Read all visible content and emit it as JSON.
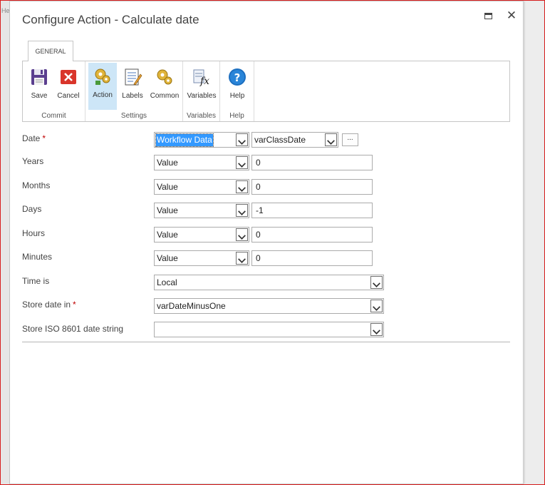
{
  "background": {
    "tab_fragment": "He"
  },
  "dialog": {
    "title": "Configure Action - Calculate date",
    "maximize_icon": "maximize-icon",
    "close_glyph": "✕"
  },
  "ribbon": {
    "tab": "GENERAL",
    "groups": [
      {
        "label": "Commit",
        "buttons": [
          {
            "label": "Save",
            "icon": "floppy-disk-icon"
          },
          {
            "label": "Cancel",
            "icon": "red-x-icon"
          }
        ]
      },
      {
        "label": "Settings",
        "buttons": [
          {
            "label": "Action",
            "icon": "gears-icon",
            "active": true
          },
          {
            "label": "Labels",
            "icon": "labels-notepad-icon"
          },
          {
            "label": "Common",
            "icon": "gears-icon"
          }
        ]
      },
      {
        "label": "Variables",
        "buttons": [
          {
            "label": "Variables",
            "icon": "fx-icon"
          }
        ]
      },
      {
        "label": "Help",
        "buttons": [
          {
            "label": "Help",
            "icon": "help-question-icon"
          }
        ]
      }
    ]
  },
  "form": {
    "date": {
      "label": "Date",
      "required": "*",
      "source": "Workflow Data",
      "variable": "varClassDate",
      "ellipsis": "..."
    },
    "years": {
      "label": "Years",
      "type": "Value",
      "value": "0"
    },
    "months": {
      "label": "Months",
      "type": "Value",
      "value": "0"
    },
    "days": {
      "label": "Days",
      "type": "Value",
      "value": "-1"
    },
    "hours": {
      "label": "Hours",
      "type": "Value",
      "value": "0"
    },
    "minutes": {
      "label": "Minutes",
      "type": "Value",
      "value": "0"
    },
    "time_is": {
      "label": "Time is",
      "value": "Local"
    },
    "store_date": {
      "label": "Store date in",
      "required": "*",
      "value": "varDateMinusOne"
    },
    "store_iso": {
      "label": "Store ISO 8601 date string",
      "value": ""
    }
  },
  "colors": {
    "accent": "#3399ff",
    "ribbon_active": "#cde6f7",
    "required": "#bf0000",
    "frame": "#d81e1e"
  }
}
